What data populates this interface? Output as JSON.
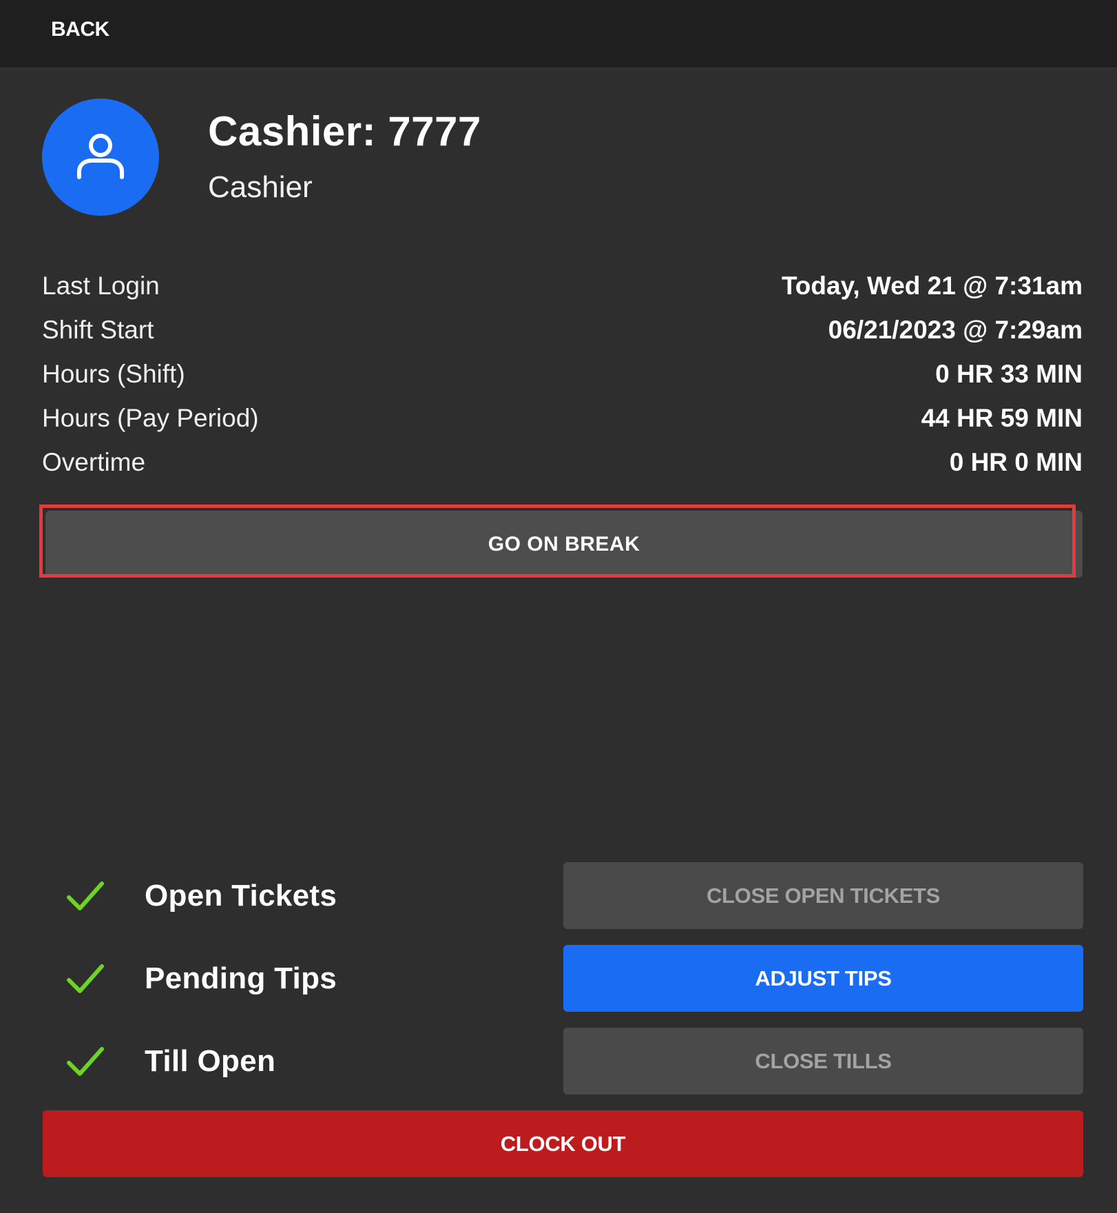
{
  "topbar": {
    "back_label": "BACK"
  },
  "profile": {
    "avatar_icon": "user-icon",
    "title": "Cashier: 7777",
    "role": "Cashier"
  },
  "info": [
    {
      "label": "Last Login",
      "value": "Today, Wed 21 @ 7:31am"
    },
    {
      "label": "Shift Start",
      "value": "06/21/2023 @ 7:29am"
    },
    {
      "label": "Hours (Shift)",
      "value": "0 HR 33 MIN"
    },
    {
      "label": "Hours (Pay Period)",
      "value": "44 HR 59 MIN"
    },
    {
      "label": "Overtime",
      "value": "0 HR 0 MIN"
    }
  ],
  "break_button": {
    "label": "GO ON BREAK"
  },
  "checklist": [
    {
      "icon": "check-icon",
      "label": "Open Tickets",
      "action": "CLOSE OPEN TICKETS",
      "action_enabled": false
    },
    {
      "icon": "check-icon",
      "label": "Pending Tips",
      "action": "ADJUST TIPS",
      "action_enabled": true
    },
    {
      "icon": "check-icon",
      "label": "Till Open",
      "action": "CLOSE TILLS",
      "action_enabled": false
    }
  ],
  "clock_out": {
    "label": "CLOCK OUT"
  },
  "colors": {
    "background": "#2e2e2f",
    "topbar": "#1f1f20",
    "accent_blue": "#1a6df2",
    "danger_red": "#bd1c1f",
    "highlight_red": "#e63a3c",
    "check_green": "#6cd426",
    "disabled_button": "#4a4a4b"
  }
}
